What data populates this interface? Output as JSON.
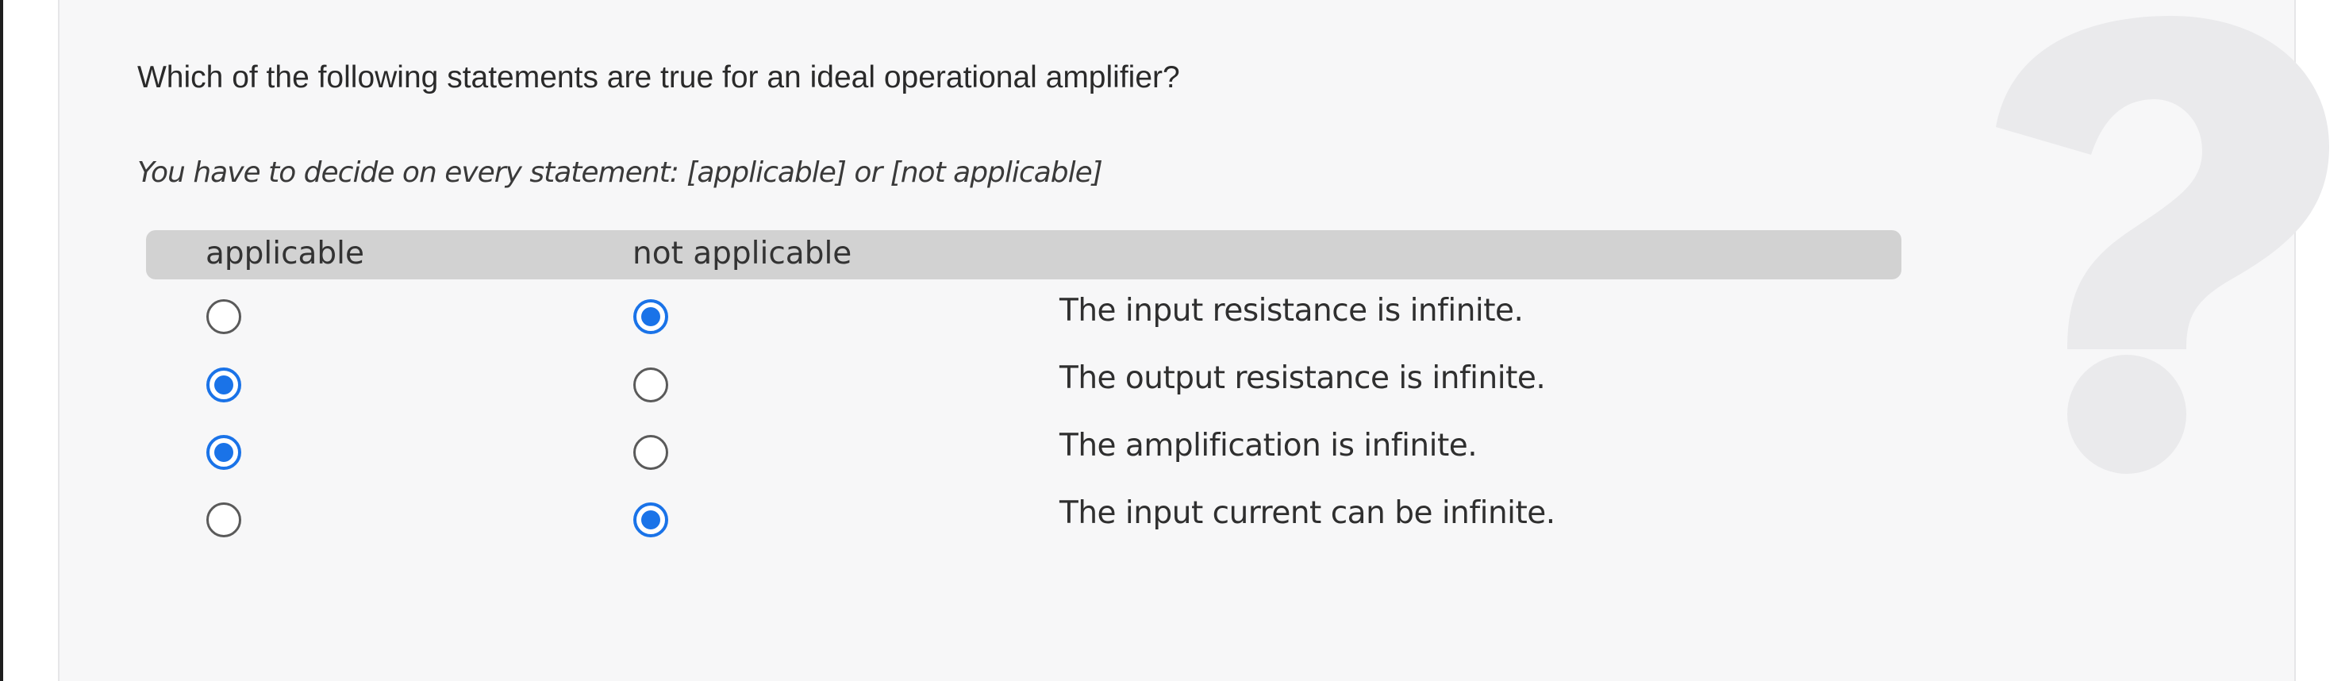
{
  "question": {
    "text": "Which of the following statements are true for an ideal operational amplifier?",
    "instruction": "You have to decide on every statement: [applicable] or [not applicable]"
  },
  "table": {
    "headers": [
      "applicable",
      "not applicable"
    ],
    "rows": [
      {
        "statement": "The input resistance is infinite.",
        "selected": "not applicable"
      },
      {
        "statement": "The output resistance is infinite.",
        "selected": "applicable"
      },
      {
        "statement": "The amplification is infinite.",
        "selected": "applicable"
      },
      {
        "statement": "The input current can be infinite.",
        "selected": "not applicable"
      }
    ]
  },
  "decoration": {
    "icon": "question-mark-icon",
    "color": "#eaeaec"
  },
  "colors": {
    "accent": "#1a73e8",
    "header_bar": "#d2d2d2"
  }
}
